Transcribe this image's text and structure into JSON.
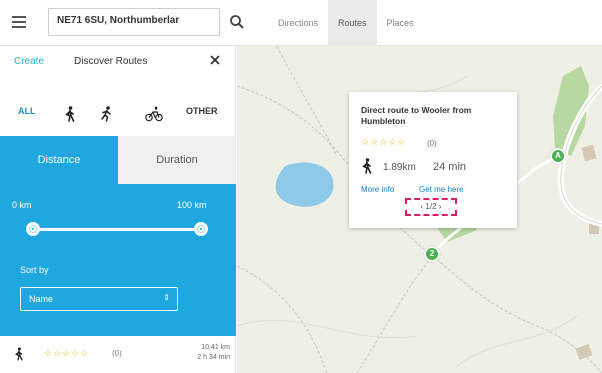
{
  "topbar": {
    "search_value": "NE71 6SU, Northumberlar",
    "tabs": [
      "Directions",
      "Routes",
      "Places"
    ],
    "active_tab": "Routes"
  },
  "panel": {
    "create_label": "Create",
    "title": "Discover Routes",
    "close_icon": "close-icon",
    "modes": {
      "all": "ALL",
      "other": "OTHER"
    },
    "distance_label": "Distance",
    "duration_label": "Duration",
    "range_min": "0 km",
    "range_max": "100 km",
    "sort_label": "Sort by",
    "sort_value": "Name",
    "accent": "#1fa7e0"
  },
  "result": {
    "stars": "☆☆☆☆☆",
    "count": "(0)",
    "distance": "10.41 km",
    "time": "2 h 34 min"
  },
  "popup": {
    "title": "Direct route to Wooler from Humbleton",
    "stars": "☆☆☆☆☆",
    "count": "(0)",
    "distance": "1.89km",
    "time": "24 min",
    "more_info": "More info",
    "get_me_here": "Get me here",
    "pager": "‹ 1/2 ›"
  },
  "markers": {
    "a": "A",
    "b": "2",
    "color": "#4caf50"
  }
}
